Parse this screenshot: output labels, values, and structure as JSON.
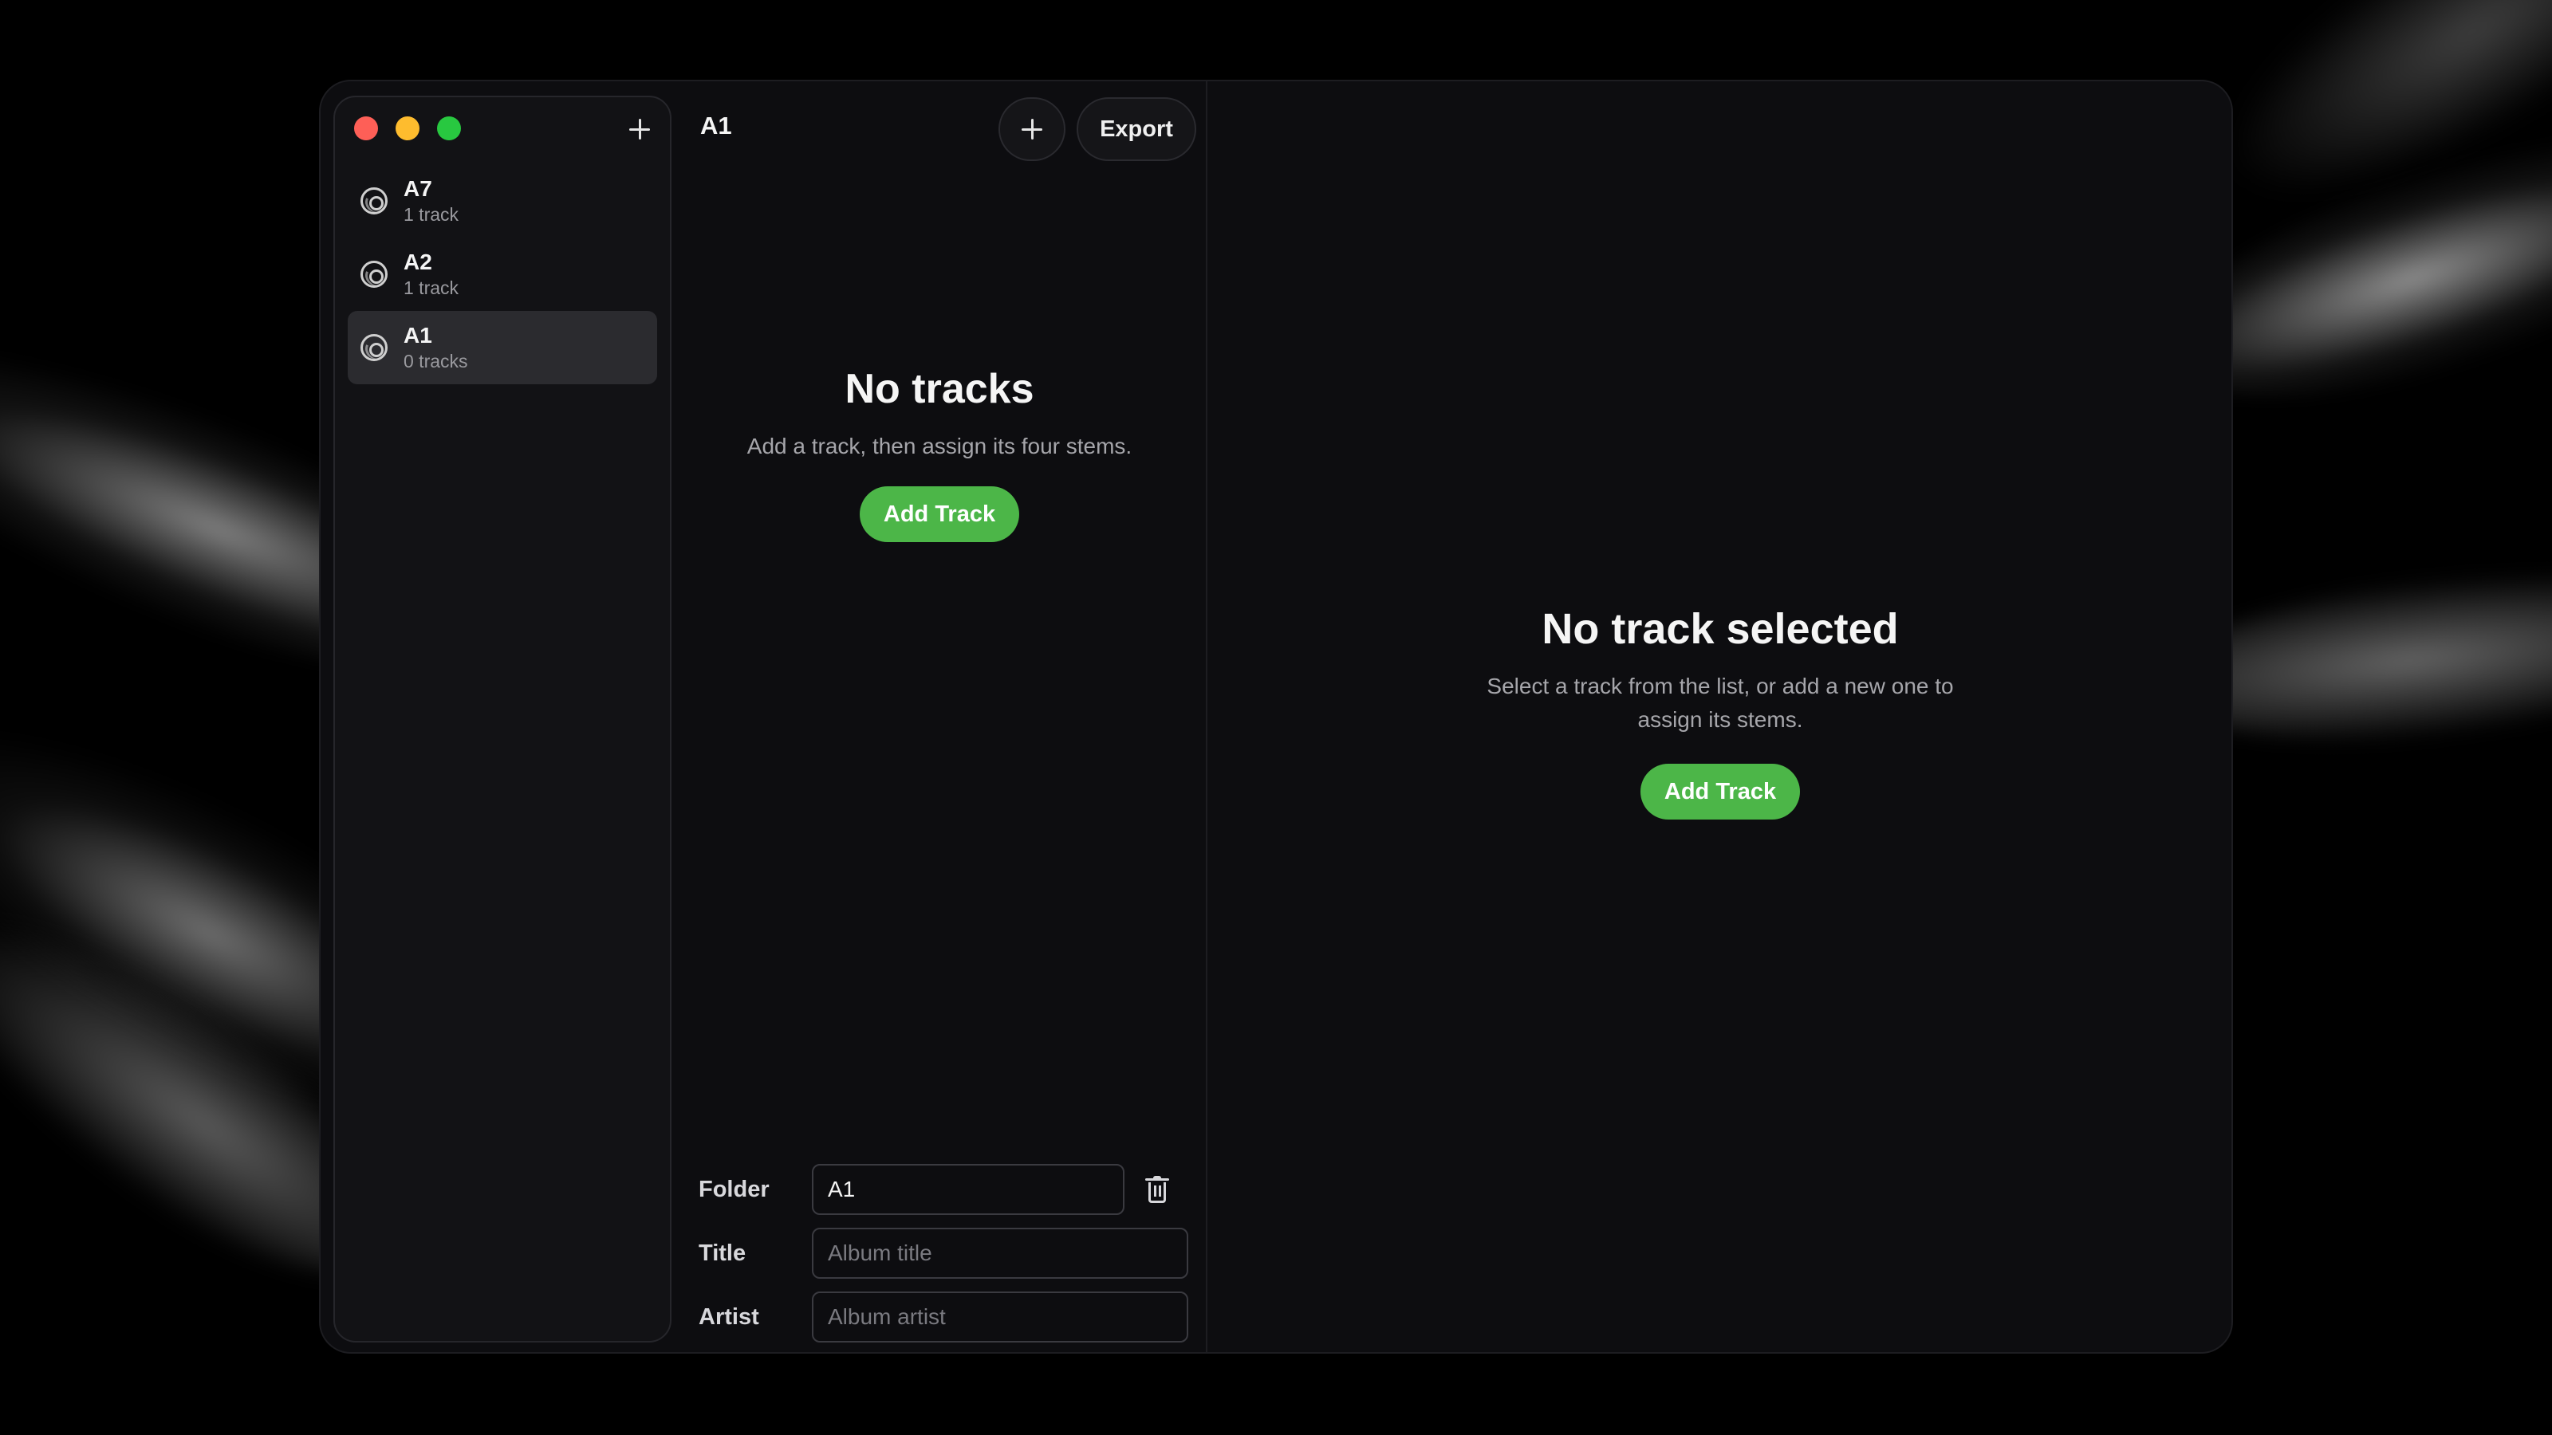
{
  "sidebar": {
    "window_controls": [
      "close",
      "minimize",
      "zoom"
    ],
    "add_icon": "plus-icon",
    "folders": [
      {
        "name": "A7",
        "count": "1 track",
        "selected": false,
        "icon": "disc-icon"
      },
      {
        "name": "A2",
        "count": "1 track",
        "selected": false,
        "icon": "disc-icon"
      },
      {
        "name": "A1",
        "count": "0 tracks",
        "selected": true,
        "icon": "disc-icon"
      }
    ]
  },
  "middle": {
    "title": "A1",
    "add_icon": "plus-icon",
    "export_label": "Export",
    "empty": {
      "title": "No tracks",
      "subtitle": "Add a track, then assign its four stems.",
      "button": "Add Track"
    },
    "form": {
      "folder_label": "Folder",
      "folder_value": "A1",
      "title_label": "Title",
      "title_placeholder": "Album title",
      "artist_label": "Artist",
      "artist_placeholder": "Album artist",
      "delete_icon": "trash-icon"
    }
  },
  "detail": {
    "title": "No track selected",
    "subtitle": "Select a track from the list, or add a new one to assign its stems.",
    "button": "Add Track"
  },
  "colors": {
    "accent_green": "#4cb648",
    "close": "#fe5f57",
    "minimize": "#febc2e",
    "zoom": "#28c840",
    "window_bg": "#0d0d10",
    "selected_row": "#2b2b2f"
  }
}
